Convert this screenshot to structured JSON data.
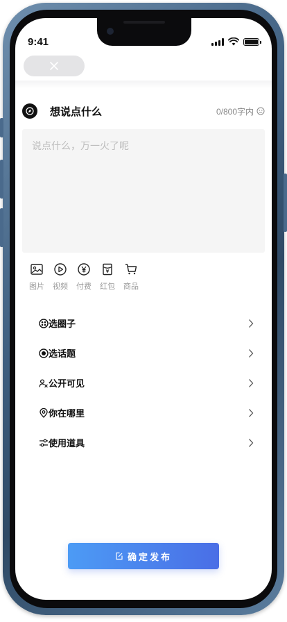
{
  "status_bar": {
    "time": "9:41"
  },
  "header": {
    "close_icon": "close-x-icon"
  },
  "compose": {
    "title": "想说点什么",
    "char_count": "0/800字内",
    "placeholder": "说点什么，万一火了呢"
  },
  "media": [
    {
      "label": "图片",
      "icon": "image-icon"
    },
    {
      "label": "视频",
      "icon": "play-icon"
    },
    {
      "label": "付费",
      "icon": "yen-icon"
    },
    {
      "label": "红包",
      "icon": "red-envelope-icon"
    },
    {
      "label": "商品",
      "icon": "cart-icon"
    }
  ],
  "options": [
    {
      "label": "选圈子",
      "icon": "circle-group-icon"
    },
    {
      "label": "选话题",
      "icon": "topic-icon"
    },
    {
      "label": "公开可见",
      "icon": "people-icon"
    },
    {
      "label": "你在哪里",
      "icon": "location-icon"
    },
    {
      "label": "使用道具",
      "icon": "tools-icon"
    }
  ],
  "publish": {
    "label": "确定发布",
    "icon": "edit-icon"
  },
  "colors": {
    "accent_start": "#4c9bf5",
    "accent_end": "#4a6ee6"
  }
}
